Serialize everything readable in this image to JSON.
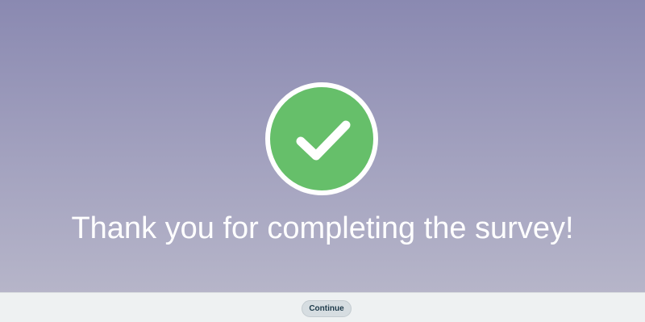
{
  "completion": {
    "message": "Thank you for completing the survey!",
    "icon": "checkmark-circle-icon",
    "icon_color": "#66bf6a"
  },
  "footer": {
    "continue_label": "Continue"
  }
}
